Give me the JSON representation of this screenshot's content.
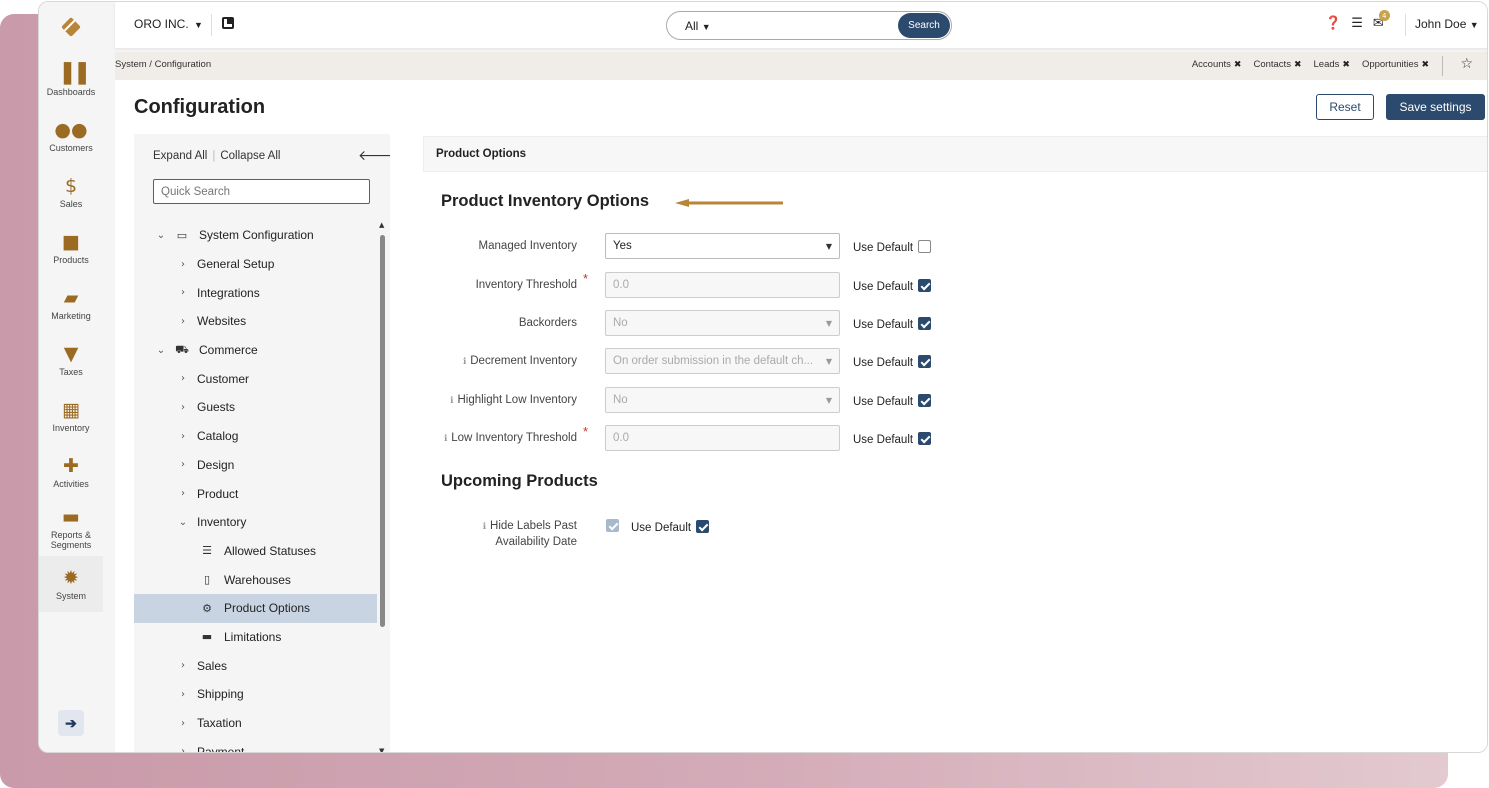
{
  "nav": {
    "items": [
      {
        "label": "Dashboards",
        "icon": "dashboards-icon"
      },
      {
        "label": "Customers",
        "icon": "customers-icon"
      },
      {
        "label": "Sales",
        "icon": "sales-icon"
      },
      {
        "label": "Products",
        "icon": "products-icon"
      },
      {
        "label": "Marketing",
        "icon": "marketing-icon"
      },
      {
        "label": "Taxes",
        "icon": "taxes-icon"
      },
      {
        "label": "Inventory",
        "icon": "inventory-icon"
      },
      {
        "label": "Activities",
        "icon": "activities-icon"
      },
      {
        "label": "Reports & Segments",
        "icon": "reports-icon"
      },
      {
        "label": "System",
        "icon": "system-icon"
      }
    ]
  },
  "topbar": {
    "org": "ORO INC.",
    "search_scope": "All",
    "search_button": "Search",
    "notification_count": "4",
    "user": "John Doe"
  },
  "breadcrumb": "System / Configuration",
  "pins": [
    "Accounts",
    "Contacts",
    "Leads",
    "Opportunities"
  ],
  "page": {
    "title": "Configuration",
    "reset": "Reset",
    "save": "Save settings"
  },
  "tree": {
    "expand_all": "Expand All",
    "collapse_all": "Collapse All",
    "search_placeholder": "Quick Search",
    "nodes": [
      {
        "label": "System Configuration"
      },
      {
        "label": "General Setup"
      },
      {
        "label": "Integrations"
      },
      {
        "label": "Websites"
      },
      {
        "label": "Commerce"
      },
      {
        "label": "Customer"
      },
      {
        "label": "Guests"
      },
      {
        "label": "Catalog"
      },
      {
        "label": "Design"
      },
      {
        "label": "Product"
      },
      {
        "label": "Inventory"
      },
      {
        "label": "Allowed Statuses"
      },
      {
        "label": "Warehouses"
      },
      {
        "label": "Product Options"
      },
      {
        "label": "Limitations"
      },
      {
        "label": "Sales"
      },
      {
        "label": "Shipping"
      },
      {
        "label": "Taxation"
      },
      {
        "label": "Payment"
      }
    ]
  },
  "content": {
    "section": "Product Options",
    "group1": "Product Inventory Options",
    "group2": "Upcoming Products",
    "use_default": "Use Default",
    "fields": [
      {
        "label": "Managed Inventory",
        "value": "Yes",
        "use_default": false
      },
      {
        "label": "Inventory Threshold",
        "value": "0.0",
        "use_default": true
      },
      {
        "label": "Backorders",
        "value": "No",
        "use_default": true
      },
      {
        "label": "Decrement Inventory",
        "value": "On order submission in the default ch...",
        "use_default": true
      },
      {
        "label": "Highlight Low Inventory",
        "value": "No",
        "use_default": true
      },
      {
        "label": "Low Inventory Threshold",
        "value": "0.0",
        "use_default": true
      }
    ],
    "hide_labels_line1": "Hide Labels Past",
    "hide_labels_line2": "Availability Date"
  },
  "colors": {
    "brand": "#9b6b24",
    "primary": "#2c4a6d",
    "selected": "#c9d4e3",
    "arrow": "#b8853a"
  }
}
